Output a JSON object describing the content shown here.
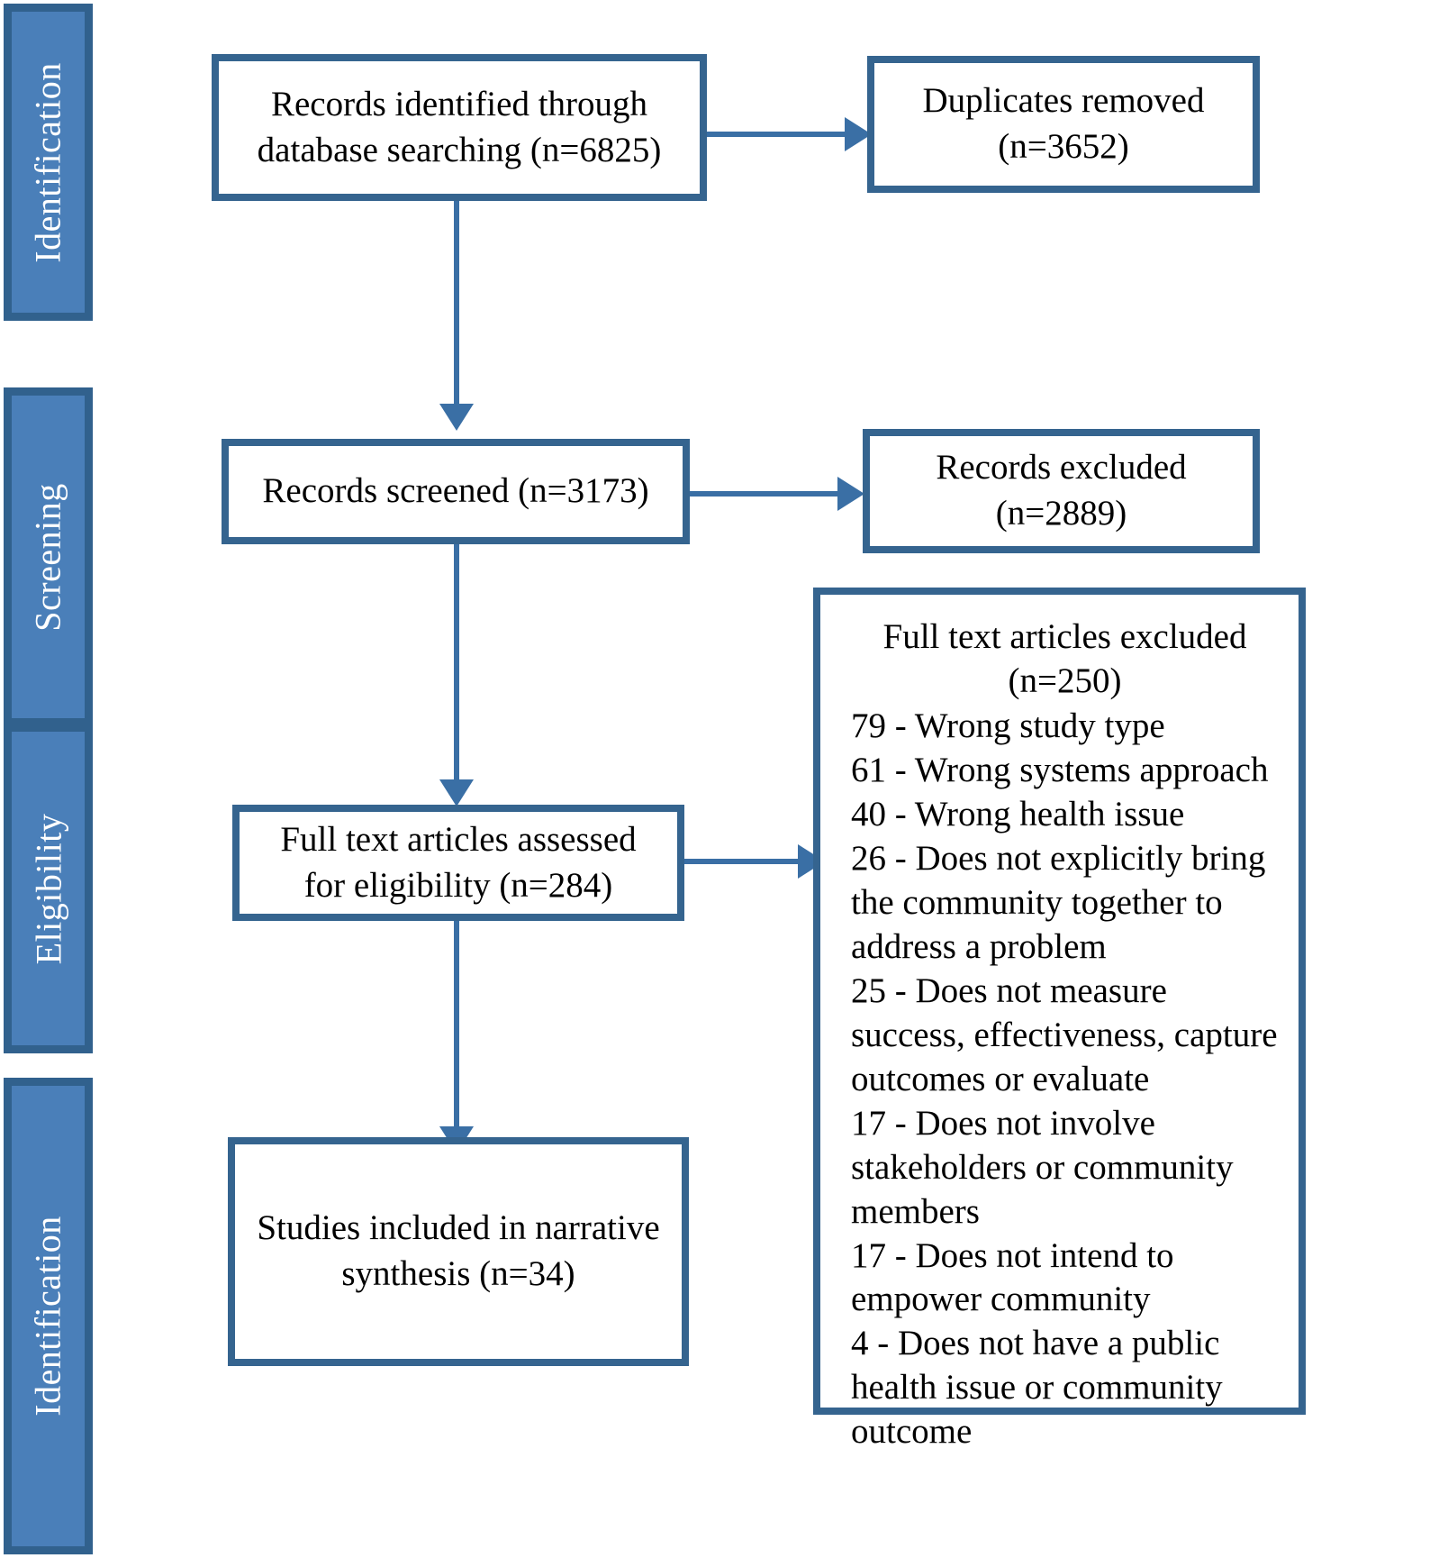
{
  "diagram": {
    "type": "prisma-flow-diagram",
    "colors": {
      "stage_fill": "#4a7fb9",
      "stage_border": "#31618d",
      "box_border": "#35648f",
      "box_fill": "#ffffff",
      "connector": "#3a6fa5",
      "stage_text": "#ffffff",
      "box_text": "#000000"
    },
    "stages": [
      {
        "label": "Identification"
      },
      {
        "label": "Screening"
      },
      {
        "label": "Eligibility"
      },
      {
        "label": "Identification"
      }
    ],
    "boxes": {
      "identified": {
        "line1": "Records identified through",
        "line2": "database searching (n=6825)"
      },
      "duplicates_removed": {
        "line1": "Duplicates removed",
        "line2": "(n=3652)"
      },
      "screened": {
        "line1": "Records screened (n=3173)"
      },
      "records_excluded": {
        "line1": "Records excluded",
        "line2": "(n=2889)"
      },
      "fulltext_assessed": {
        "line1": "Full text articles assessed",
        "line2": "for eligibility (n=284)"
      },
      "included": {
        "line1": "Studies included in narrative",
        "line2": "synthesis (n=34)"
      },
      "fulltext_excluded": {
        "heading_line1": "Full text articles excluded",
        "heading_line2": "(n=250)",
        "reasons": [
          "79 - Wrong study type",
          "61 - Wrong systems approach",
          "40 - Wrong health issue",
          "26 - Does not explicitly bring the community together to address a problem",
          "25 - Does not measure success, effectiveness, capture outcomes or evaluate",
          "17 - Does not involve stakeholders or community members",
          "17 - Does not intend to empower community",
          "4 - Does not have a public health issue or community outcome"
        ]
      }
    }
  },
  "chart_data": {
    "type": "table",
    "title": "PRISMA study selection flow",
    "stages": [
      "Identification",
      "Screening",
      "Eligibility",
      "Identification"
    ],
    "nodes": [
      {
        "id": "identified",
        "label": "Records identified through database searching",
        "n": 6825
      },
      {
        "id": "duplicates_removed",
        "label": "Duplicates removed",
        "n": 3652
      },
      {
        "id": "screened",
        "label": "Records screened",
        "n": 3173
      },
      {
        "id": "records_excluded",
        "label": "Records excluded",
        "n": 2889
      },
      {
        "id": "fulltext_assessed",
        "label": "Full text articles assessed for eligibility",
        "n": 284
      },
      {
        "id": "fulltext_excluded",
        "label": "Full text articles excluded",
        "n": 250
      },
      {
        "id": "included",
        "label": "Studies included in narrative synthesis",
        "n": 34
      }
    ],
    "exclusion_reasons": {
      "total": 250,
      "categories": [
        {
          "count": 79,
          "reason": "Wrong study type"
        },
        {
          "count": 61,
          "reason": "Wrong systems approach"
        },
        {
          "count": 40,
          "reason": "Wrong health issue"
        },
        {
          "count": 26,
          "reason": "Does not explicitly bring the community together to address a problem"
        },
        {
          "count": 25,
          "reason": "Does not measure success, effectiveness, capture outcomes or evaluate"
        },
        {
          "count": 17,
          "reason": "Does not involve stakeholders or community members"
        },
        {
          "count": 17,
          "reason": "Does not intend to empower community"
        },
        {
          "count": 4,
          "reason": "Does not have a public health issue or community outcome"
        }
      ]
    },
    "edges": [
      {
        "from": "identified",
        "to": "duplicates_removed"
      },
      {
        "from": "identified",
        "to": "screened"
      },
      {
        "from": "screened",
        "to": "records_excluded"
      },
      {
        "from": "screened",
        "to": "fulltext_assessed"
      },
      {
        "from": "fulltext_assessed",
        "to": "fulltext_excluded"
      },
      {
        "from": "fulltext_assessed",
        "to": "included"
      }
    ]
  }
}
